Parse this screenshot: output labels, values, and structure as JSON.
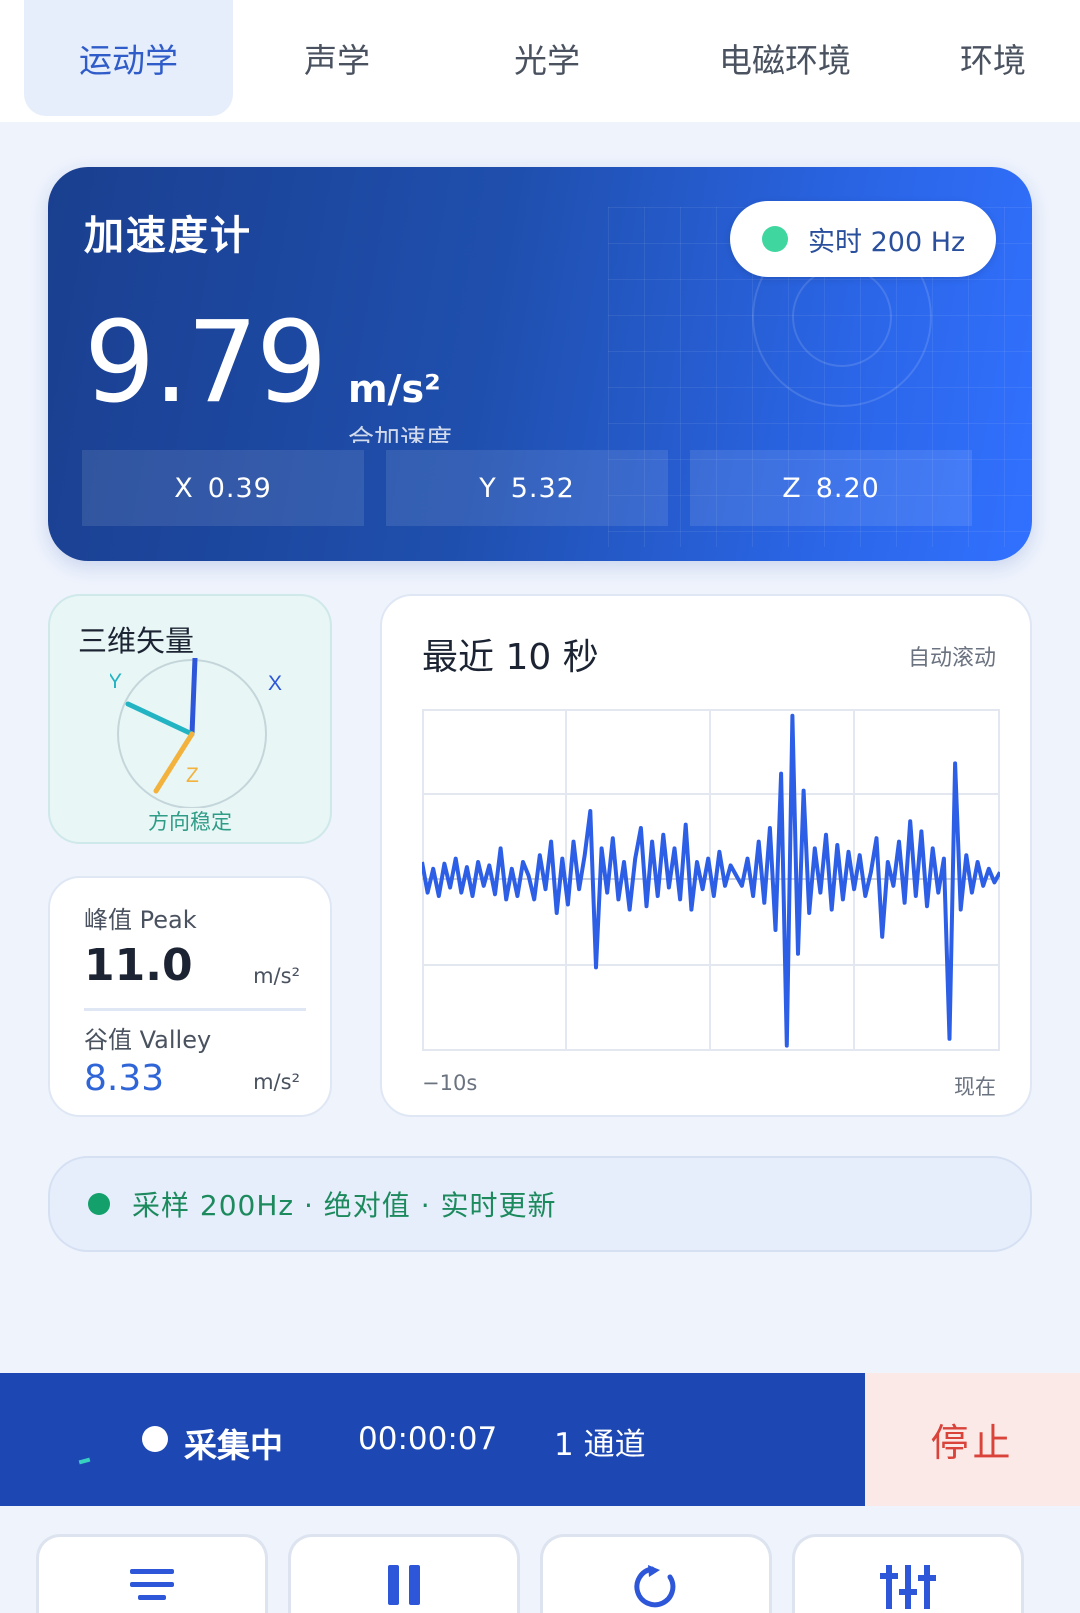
{
  "tabs": [
    {
      "label": "运动学",
      "active": true
    },
    {
      "label": "声学",
      "active": false
    },
    {
      "label": "光学",
      "active": false
    },
    {
      "label": "电磁环境",
      "active": false
    },
    {
      "label": "环境",
      "active": false
    }
  ],
  "hero": {
    "title": "加速度计",
    "live_badge": "实时 200 Hz",
    "magnitude": "9.79",
    "unit": "m/s²",
    "caption": "合加速度",
    "axes": [
      {
        "name": "X",
        "value": "0.39"
      },
      {
        "name": "Y",
        "value": "5.32"
      },
      {
        "name": "Z",
        "value": "8.20"
      }
    ]
  },
  "vector3d": {
    "title": "三维矢量",
    "axis_labels": {
      "x": "X",
      "y": "Y",
      "z": "Z"
    },
    "status": "方向稳定",
    "colors": {
      "x": "#2d56d8",
      "y": "#23b4c4",
      "z": "#f2b23c"
    }
  },
  "peak_valley": {
    "peak_label": "峰值 Peak",
    "peak_value": "11.0",
    "peak_unit": "m/s²",
    "valley_label": "谷值 Valley",
    "valley_value": "8.33",
    "valley_unit": "m/s²"
  },
  "chart": {
    "title": "最近 10 秒",
    "subtitle": "自动滚动",
    "x_start_label": "−10s",
    "x_end_label": "现在"
  },
  "chart_data": {
    "type": "line",
    "title": "最近 10 秒",
    "xlabel": "",
    "ylabel": "",
    "x_ticks": [
      "−10s",
      "现在"
    ],
    "grid": true,
    "series_color": "#2d5ee6",
    "values": [
      0.1,
      -0.08,
      0.06,
      -0.1,
      0.09,
      -0.05,
      0.12,
      -0.08,
      0.07,
      -0.1,
      0.1,
      -0.04,
      0.08,
      -0.09,
      0.18,
      -0.12,
      0.06,
      -0.1,
      0.1,
      0.02,
      -0.12,
      0.14,
      -0.06,
      0.22,
      -0.2,
      0.12,
      -0.15,
      0.22,
      -0.06,
      0.14,
      0.4,
      -0.52,
      0.18,
      -0.08,
      0.24,
      -0.12,
      0.1,
      -0.18,
      0.12,
      0.3,
      -0.16,
      0.22,
      -0.1,
      0.26,
      -0.05,
      0.18,
      -0.12,
      0.32,
      -0.18,
      0.1,
      -0.06,
      0.12,
      -0.1,
      0.16,
      -0.04,
      0.08,
      0.02,
      -0.04,
      0.12,
      -0.1,
      0.22,
      -0.14,
      0.3,
      -0.3,
      0.62,
      -0.98,
      0.96,
      -0.44,
      0.52,
      -0.2,
      0.18,
      -0.08,
      0.26,
      -0.18,
      0.2,
      -0.12,
      0.16,
      -0.06,
      0.14,
      -0.1,
      0.04,
      0.24,
      -0.34,
      0.1,
      -0.04,
      0.22,
      -0.14,
      0.34,
      -0.1,
      0.28,
      -0.16,
      0.18,
      -0.08,
      0.12,
      -0.94,
      0.68,
      -0.18,
      0.14,
      -0.08,
      0.1,
      -0.04,
      0.06,
      -0.02,
      0.04
    ]
  },
  "status_strip": {
    "text": "采样 200Hz · 绝对值 · 实时更新"
  },
  "recording": {
    "status": "采集中",
    "elapsed": "00:00:07",
    "channels": "1 通道",
    "stop_label": "停止"
  },
  "toolbar": {
    "buttons": [
      {
        "icon": "menu-icon"
      },
      {
        "icon": "pause-icon"
      },
      {
        "icon": "refresh-icon"
      },
      {
        "icon": "sliders-icon"
      }
    ]
  }
}
